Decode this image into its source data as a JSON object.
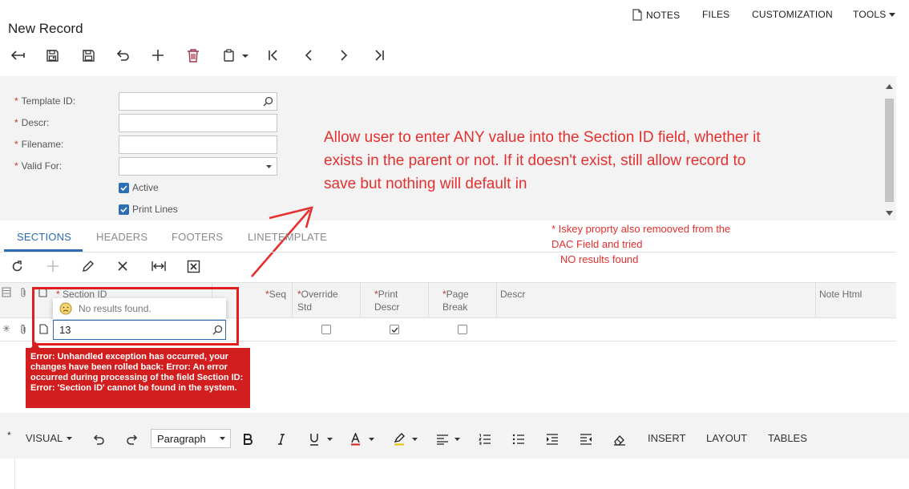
{
  "header": {
    "title": "New Record",
    "menu": [
      {
        "label": "NOTES"
      },
      {
        "label": "FILES"
      },
      {
        "label": "CUSTOMIZATION"
      },
      {
        "label": "TOOLS"
      }
    ]
  },
  "toolbar": {
    "icons": [
      "back-arrow-icon",
      "save-close-icon",
      "save-icon",
      "undo-icon",
      "add-icon",
      "delete-icon",
      "copy-paste-icon",
      "first-record-icon",
      "previous-record-icon",
      "next-record-icon",
      "last-record-icon"
    ]
  },
  "form": {
    "fields": [
      {
        "label": "Template ID:",
        "value": ""
      },
      {
        "label": "Descr:",
        "value": ""
      },
      {
        "label": "Filename:",
        "value": ""
      },
      {
        "label": "Valid For:",
        "value": ""
      }
    ],
    "checkboxes": [
      {
        "label": "Active",
        "checked": true
      },
      {
        "label": "Print Lines",
        "checked": true
      }
    ]
  },
  "annotation": {
    "main": "Allow user to enter ANY value into the Section ID field, whether it exists in the parent or not.  If it doesn't exist, still allow record to save but nothing will default in",
    "note": "* Iskey proprty also remooved from the\nDAC Field and tried\n   NO results found",
    "color": "#e53030"
  },
  "tabs": [
    {
      "label": "SECTIONS",
      "active": true
    },
    {
      "label": "HEADERS",
      "active": false
    },
    {
      "label": "FOOTERS",
      "active": false
    },
    {
      "label": "LINETEMPLATE",
      "active": false
    }
  ],
  "grid": {
    "toolbar_icons": [
      "refresh-icon",
      "add-row-icon",
      "edit-icon",
      "delete-row-icon",
      "fit-columns-icon",
      "export-excel-icon"
    ],
    "columns": [
      {
        "label": "Section ID",
        "required": true
      },
      {
        "label": "Seq",
        "required": true
      },
      {
        "label": "Override\nStd",
        "required": true
      },
      {
        "label": "Print\nDescr",
        "required": true
      },
      {
        "label": "Page\nBreak",
        "required": true
      },
      {
        "label": "Descr",
        "required": false
      },
      {
        "label": "Note Html",
        "required": false
      }
    ],
    "row": {
      "marker": "✳",
      "section_id": "13",
      "override_std": false,
      "print_descr": true,
      "page_break": false
    },
    "lookup_message": "No results found."
  },
  "error": {
    "message": "Error: Unhandled exception has occurred, your changes have been rolled back: Error: An error occurred during processing of the field Section ID: Error: 'Section ID' cannot be found in the system."
  },
  "editor": {
    "required_marker": "*",
    "mode": "VISUAL",
    "paragraph": "Paragraph",
    "menus": [
      {
        "label": "INSERT"
      },
      {
        "label": "LAYOUT"
      },
      {
        "label": "TABLES"
      }
    ]
  },
  "colors": {
    "accent": "#2a6cb0",
    "error": "#d21e1e",
    "panel": "#f3f3f3"
  }
}
